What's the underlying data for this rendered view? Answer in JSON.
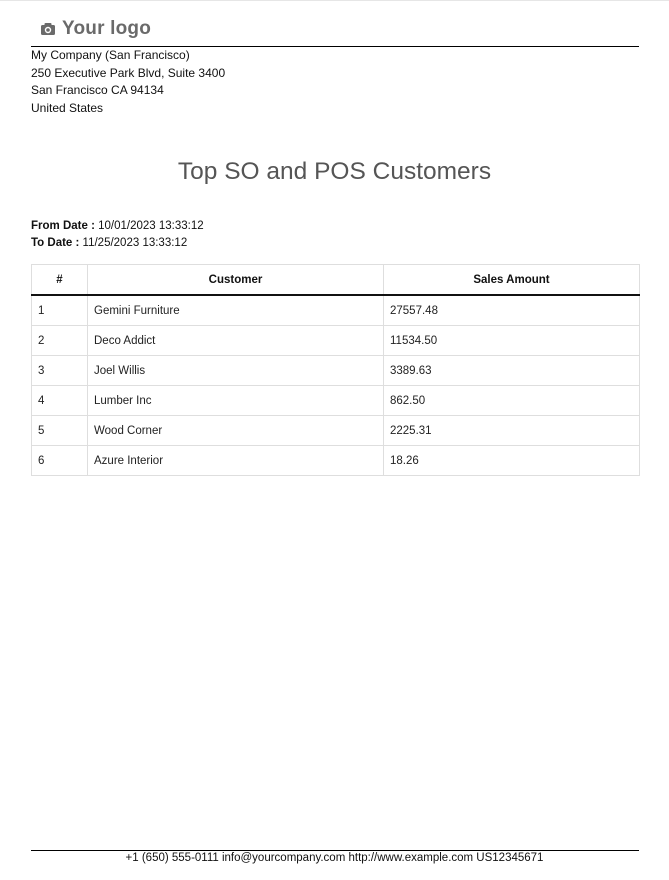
{
  "logo": {
    "icon": "camera-icon",
    "text": "Your logo"
  },
  "company": {
    "name": "My Company (San Francisco)",
    "street": "250 Executive Park Blvd, Suite 3400",
    "city": "San Francisco CA 94134",
    "country": "United States"
  },
  "report": {
    "title": "Top SO and POS Customers",
    "from_label": "From Date :",
    "from_value": "10/01/2023 13:33:12",
    "to_label": "To Date :",
    "to_value": "11/25/2023 13:33:12"
  },
  "table": {
    "headers": [
      "#",
      "Customer",
      "Sales Amount"
    ],
    "rows": [
      [
        "1",
        "Gemini Furniture",
        "27557.48"
      ],
      [
        "2",
        "Deco Addict",
        "11534.50"
      ],
      [
        "3",
        "Joel Willis",
        "3389.63"
      ],
      [
        "4",
        "Lumber Inc",
        "862.50"
      ],
      [
        "5",
        "Wood Corner",
        "2225.31"
      ],
      [
        "6",
        "Azure Interior",
        "18.26"
      ]
    ]
  },
  "footer": {
    "text": "+1 (650) 555-0111 info@yourcompany.com http://www.example.com US12345671"
  }
}
